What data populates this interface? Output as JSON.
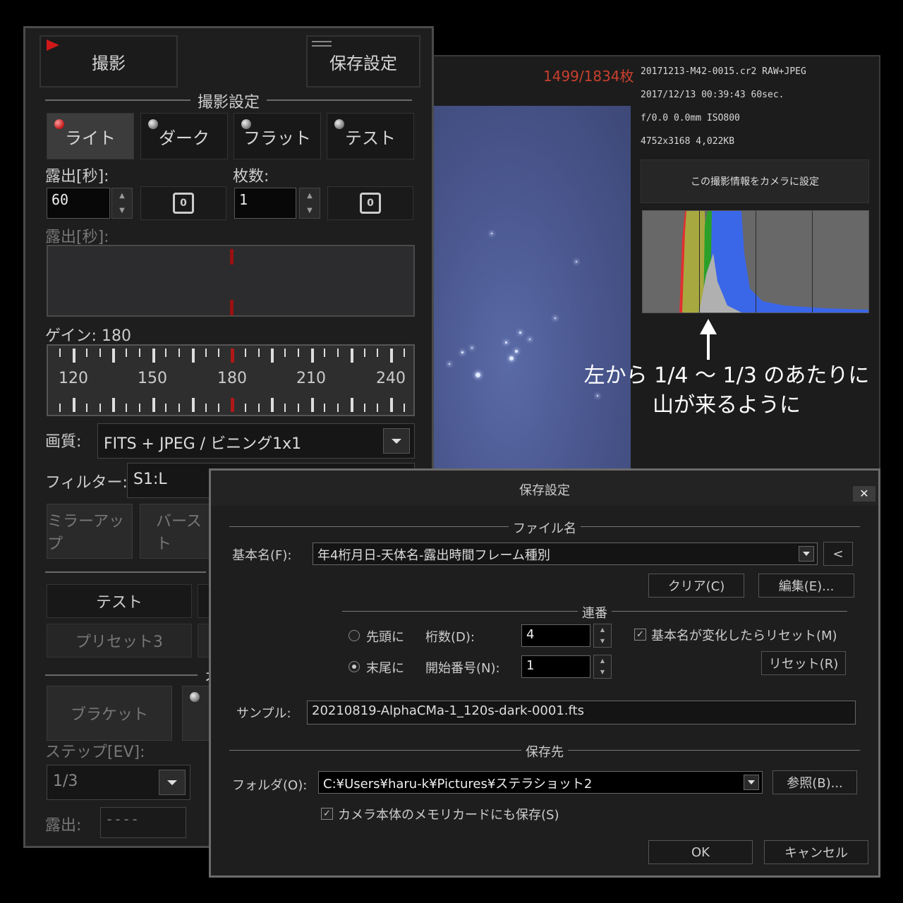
{
  "info": {
    "frame_count": "1499/1834枚",
    "file_line": "20171213-M42-0015.cr2 RAW+JPEG",
    "date_line": "2017/12/13 00:39:43 60sec.",
    "lens_line": "f/0.0 0.0mm ISO800",
    "size_line": "4752x3168 4,022KB",
    "apply_button": "この撮影情報をカメラに設定",
    "annotation_line1": "左から 1/4 〜 1/3 のあたりに",
    "annotation_line2": "山が来るように"
  },
  "capture_panel": {
    "tab_capture": "撮影",
    "tab_save_settings": "保存設定",
    "section_capture_settings": "撮影設定",
    "modes": [
      "ライト",
      "ダーク",
      "フラット",
      "テスト"
    ],
    "active_mode": "ライト",
    "exposure_label": "露出[秒]:",
    "exposure_value": "60",
    "count_label": "枚数:",
    "count_value": "1",
    "exposure_label_dim": "露出[秒]:",
    "gain_label": "ゲイン: 180",
    "gain_ticks": [
      "120",
      "150",
      "180",
      "210",
      "240"
    ],
    "gain_value": 180,
    "quality_label": "画質:",
    "quality_value": "FITS + JPEG / ビニング1x1",
    "filter_label": "フィルター:",
    "filter_value": "S1:L",
    "mirror_up": "ミラーアップ",
    "burst": "バースト",
    "test_button": "テスト",
    "preset_button": "プリセット3",
    "section_auto": "オート",
    "bracket": "ブラケット",
    "step_label": "ステップ[EV]:",
    "step_value": "1/3",
    "exposure_bottom_label": "露出:",
    "exposure_bottom_value": "----"
  },
  "dialog": {
    "title": "保存設定",
    "close": "✕",
    "section_filename": "ファイル名",
    "basename_label": "基本名(F):",
    "basename_value": "年4桁月日-天体名-露出時間フレーム種別",
    "back_button": "<",
    "clear_button": "クリア(C)",
    "edit_button": "編集(E)...",
    "section_serial": "連番",
    "radio_head": "先頭に",
    "radio_tail": "末尾に",
    "selected_position": "末尾に",
    "digits_label": "桁数(D):",
    "digits_value": "4",
    "start_label": "開始番号(N):",
    "start_value": "1",
    "reset_on_change": "基本名が変化したらリセット(M)",
    "reset_on_change_checked": true,
    "reset_button": "リセット(R)",
    "sample_label": "サンプル:",
    "sample_value": "20210819-AlphaCMa-1_120s-dark-0001.fts",
    "section_destination": "保存先",
    "folder_label": "フォルダ(O):",
    "folder_value": "C:¥Users¥haru-k¥Pictures¥ステラショット2",
    "browse_button": "参照(B)...",
    "save_to_card": "カメラ本体のメモリカードにも保存(S)",
    "save_to_card_checked": true,
    "ok_button": "OK",
    "cancel_button": "キャンセル"
  }
}
